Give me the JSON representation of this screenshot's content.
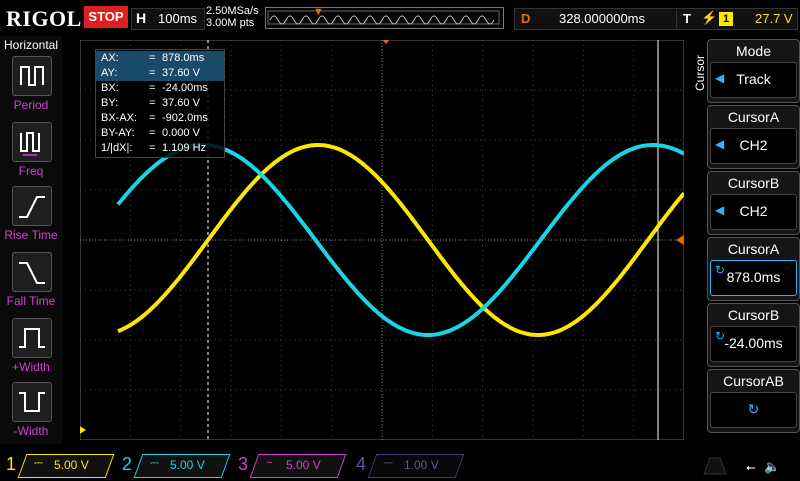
{
  "topbar": {
    "logo": "RIGOL",
    "run_state": "STOP",
    "horizontal_key": "H",
    "timebase": "100ms",
    "sample_rate": "2.50MSa/s",
    "memory_depth": "3.00M pts",
    "delay_key": "D",
    "delay_value": "328.000000ms",
    "trigger_key": "T",
    "trigger_source": "1",
    "trigger_level": "27.7 V"
  },
  "left_panel": {
    "title": "Horizontal",
    "items": [
      {
        "label": "Period",
        "icon": "period-icon"
      },
      {
        "label": "Freq",
        "icon": "frequency-icon"
      },
      {
        "label": "Rise Time",
        "icon": "rise-time-icon"
      },
      {
        "label": "Fall Time",
        "icon": "fall-time-icon"
      },
      {
        "label": "+Width",
        "icon": "positive-width-icon"
      },
      {
        "label": "-Width",
        "icon": "negative-width-icon"
      }
    ]
  },
  "cursor_readout": {
    "rows": [
      {
        "key": "AX:",
        "eq": "=",
        "value": "878.0ms"
      },
      {
        "key": "AY:",
        "eq": "=",
        "value": "37.60 V"
      },
      {
        "key": "BX:",
        "eq": "=",
        "value": "-24.00ms"
      },
      {
        "key": "BY:",
        "eq": "=",
        "value": "37.60 V"
      },
      {
        "key": "BX-AX:",
        "eq": "=",
        "value": "-902.0ms"
      },
      {
        "key": "BY-AY:",
        "eq": "=",
        "value": "0.000 V"
      },
      {
        "key": "1/|dX|:",
        "eq": "=",
        "value": "1.109 Hz"
      }
    ]
  },
  "right_panel": {
    "tab": "Cursor",
    "mode_title": "Mode",
    "mode_value": "Track",
    "cursorA_src_title": "CursorA",
    "cursorA_src_value": "CH2",
    "cursorB_src_title": "CursorB",
    "cursorB_src_value": "CH2",
    "cursorA_pos_title": "CursorA",
    "cursorA_pos_value": "878.0ms",
    "cursorB_pos_title": "CursorB",
    "cursorB_pos_value": "-24.00ms",
    "cursorAB_title": "CursorAB"
  },
  "channels": [
    {
      "num": "1",
      "scale": "5.00 V",
      "color": "#ffe600",
      "active": true
    },
    {
      "num": "2",
      "scale": "5.00 V",
      "color": "#1ad4e6",
      "active": true
    },
    {
      "num": "3",
      "scale": "5.00 V",
      "color": "#d040d0",
      "active": true
    },
    {
      "num": "4",
      "scale": "1.00 V",
      "color": "#4a4aa0",
      "active": false
    }
  ],
  "colors": {
    "ch1": "#ffe600",
    "ch2": "#1ad4e6",
    "ch3": "#d040d0",
    "accent": "#2ab6ff",
    "trigger": "#e86d00",
    "stop": "#e02020"
  },
  "chart_data": {
    "type": "line",
    "xlabel": "",
    "ylabel": "",
    "series": [
      {
        "color": "#ffe600",
        "waveform": "sine"
      },
      {
        "color": "#1ad4e6",
        "waveform": "sine"
      }
    ]
  }
}
